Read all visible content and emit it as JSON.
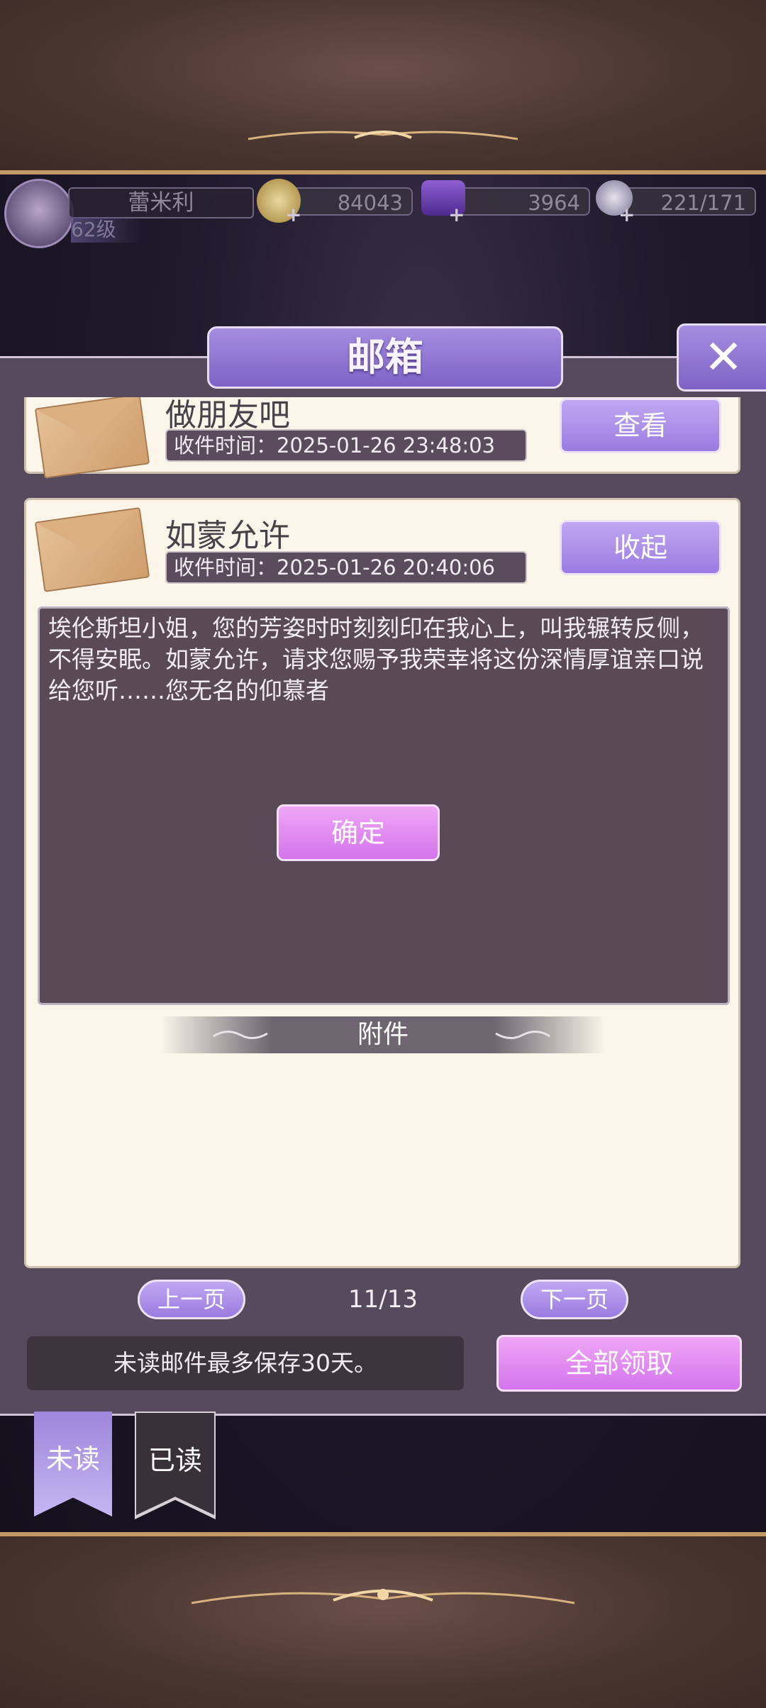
{
  "hud": {
    "player_name": "蕾米利",
    "level": "62级",
    "gold": "84043",
    "gems": "3964",
    "stamina": "221/171"
  },
  "mailbox": {
    "title": "邮箱",
    "close_icon": "close-icon"
  },
  "mails": [
    {
      "title": "做朋友吧",
      "time": "收件时间：2025-01-26 23:48:03",
      "action_label": "查看"
    },
    {
      "title": "如蒙允许",
      "time": "收件时间：2025-01-26 20:40:06",
      "action_label": "收起",
      "body": "埃伦斯坦小姐，您的芳姿时时刻刻印在我心上，叫我辗转反侧，不得安眠。如蒙允许，请求您赐予我荣幸将这份深情厚谊亲口说给您听……您无名的仰慕者",
      "attachments_label": "附件",
      "confirm_label": "确定"
    }
  ],
  "pagination": {
    "prev_label": "上一页",
    "indicator": "11/13",
    "next_label": "下一页"
  },
  "footer": {
    "notice": "未读邮件最多保存30天。",
    "claim_all_label": "全部领取"
  },
  "tabs": [
    {
      "label": "未读",
      "active": true
    },
    {
      "label": "已读",
      "active": false
    }
  ],
  "colors": {
    "accent_purple": "#9a7be0",
    "accent_pink": "#d374ec",
    "card_bg": "#fbf5ea",
    "panel_bg": "#574a5c"
  }
}
